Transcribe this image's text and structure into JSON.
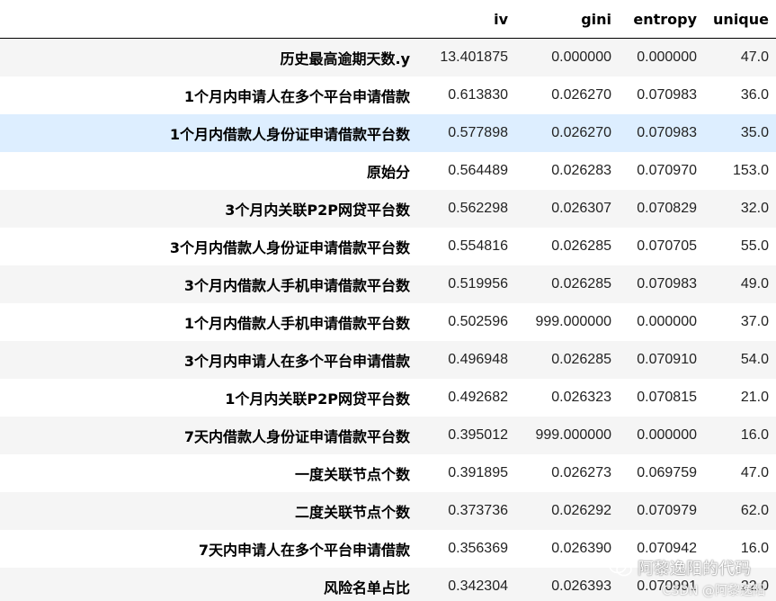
{
  "columns": [
    "",
    "iv",
    "gini",
    "entropy",
    "unique"
  ],
  "rows": [
    {
      "name": "历史最高逾期天数.y",
      "iv": "13.401875",
      "gini": "0.000000",
      "entropy": "0.000000",
      "unique": "47.0"
    },
    {
      "name": "1个月内申请人在多个平台申请借款",
      "iv": "0.613830",
      "gini": "0.026270",
      "entropy": "0.070983",
      "unique": "36.0"
    },
    {
      "name": "1个月内借款人身份证申请借款平台数",
      "iv": "0.577898",
      "gini": "0.026270",
      "entropy": "0.070983",
      "unique": "35.0"
    },
    {
      "name": "原始分",
      "iv": "0.564489",
      "gini": "0.026283",
      "entropy": "0.070970",
      "unique": "153.0"
    },
    {
      "name": "3个月内关联P2P网贷平台数",
      "iv": "0.562298",
      "gini": "0.026307",
      "entropy": "0.070829",
      "unique": "32.0"
    },
    {
      "name": "3个月内借款人身份证申请借款平台数",
      "iv": "0.554816",
      "gini": "0.026285",
      "entropy": "0.070705",
      "unique": "55.0"
    },
    {
      "name": "3个月内借款人手机申请借款平台数",
      "iv": "0.519956",
      "gini": "0.026285",
      "entropy": "0.070983",
      "unique": "49.0"
    },
    {
      "name": "1个月内借款人手机申请借款平台数",
      "iv": "0.502596",
      "gini": "999.000000",
      "entropy": "0.000000",
      "unique": "37.0"
    },
    {
      "name": "3个月内申请人在多个平台申请借款",
      "iv": "0.496948",
      "gini": "0.026285",
      "entropy": "0.070910",
      "unique": "54.0"
    },
    {
      "name": "1个月内关联P2P网贷平台数",
      "iv": "0.492682",
      "gini": "0.026323",
      "entropy": "0.070815",
      "unique": "21.0"
    },
    {
      "name": "7天内借款人身份证申请借款平台数",
      "iv": "0.395012",
      "gini": "999.000000",
      "entropy": "0.000000",
      "unique": "16.0"
    },
    {
      "name": "一度关联节点个数",
      "iv": "0.391895",
      "gini": "0.026273",
      "entropy": "0.069759",
      "unique": "47.0"
    },
    {
      "name": "二度关联节点个数",
      "iv": "0.373736",
      "gini": "0.026292",
      "entropy": "0.070979",
      "unique": "62.0"
    },
    {
      "name": "7天内申请人在多个平台申请借款",
      "iv": "0.356369",
      "gini": "0.026390",
      "entropy": "0.070942",
      "unique": "16.0"
    },
    {
      "name": "风险名单占比",
      "iv": "0.342304",
      "gini": "0.026393",
      "entropy": "0.070991",
      "unique": "22.0"
    }
  ],
  "highlighted_row": 2,
  "watermark": {
    "text": "阿黎逸阳的代码",
    "sub": "CSDN @阿黎逸阳",
    "icon": "wechat-icon"
  },
  "colors": {
    "stripe": "#f5f5f5",
    "hover": "#ddeeff",
    "header_rule": "#000000"
  }
}
